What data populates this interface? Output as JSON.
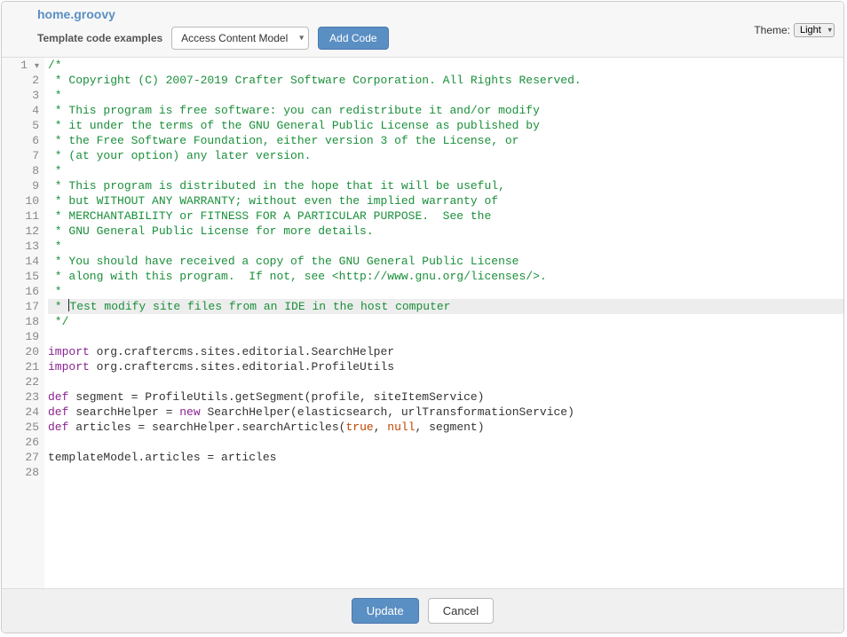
{
  "filename": "home.groovy",
  "template_label": "Template code examples",
  "model_select": "Access Content Model",
  "add_code_label": "Add Code",
  "theme_label": "Theme:",
  "theme_value": "Light",
  "update_label": "Update",
  "cancel_label": "Cancel",
  "active_line": 17,
  "code": {
    "lines": [
      {
        "n": 1,
        "fold": true,
        "spans": [
          {
            "t": "/*",
            "c": "comment"
          }
        ]
      },
      {
        "n": 2,
        "spans": [
          {
            "t": " * Copyright (C) 2007-2019 Crafter Software Corporation. All Rights Reserved.",
            "c": "comment"
          }
        ]
      },
      {
        "n": 3,
        "spans": [
          {
            "t": " *",
            "c": "comment"
          }
        ]
      },
      {
        "n": 4,
        "spans": [
          {
            "t": " * This program is free software: you can redistribute it and/or modify",
            "c": "comment"
          }
        ]
      },
      {
        "n": 5,
        "spans": [
          {
            "t": " * it under the terms of the GNU General Public License as published by",
            "c": "comment"
          }
        ]
      },
      {
        "n": 6,
        "spans": [
          {
            "t": " * the Free Software Foundation, either version 3 of the License, or",
            "c": "comment"
          }
        ]
      },
      {
        "n": 7,
        "spans": [
          {
            "t": " * (at your option) any later version.",
            "c": "comment"
          }
        ]
      },
      {
        "n": 8,
        "spans": [
          {
            "t": " *",
            "c": "comment"
          }
        ]
      },
      {
        "n": 9,
        "spans": [
          {
            "t": " * This program is distributed in the hope that it will be useful,",
            "c": "comment"
          }
        ]
      },
      {
        "n": 10,
        "spans": [
          {
            "t": " * but WITHOUT ANY WARRANTY; without even the implied warranty of",
            "c": "comment"
          }
        ]
      },
      {
        "n": 11,
        "spans": [
          {
            "t": " * MERCHANTABILITY or FITNESS FOR A PARTICULAR PURPOSE.  See the",
            "c": "comment"
          }
        ]
      },
      {
        "n": 12,
        "spans": [
          {
            "t": " * GNU General Public License for more details.",
            "c": "comment"
          }
        ]
      },
      {
        "n": 13,
        "spans": [
          {
            "t": " *",
            "c": "comment"
          }
        ]
      },
      {
        "n": 14,
        "spans": [
          {
            "t": " * You should have received a copy of the GNU General Public License",
            "c": "comment"
          }
        ]
      },
      {
        "n": 15,
        "spans": [
          {
            "t": " * along with this program.  If not, see <http://www.gnu.org/licenses/>.",
            "c": "comment"
          }
        ]
      },
      {
        "n": 16,
        "spans": [
          {
            "t": " *",
            "c": "comment"
          }
        ]
      },
      {
        "n": 17,
        "spans": [
          {
            "t": " * ",
            "c": "comment"
          },
          {
            "cursor": true
          },
          {
            "t": "Test modify site files from an IDE in the host computer",
            "c": "comment"
          }
        ]
      },
      {
        "n": 18,
        "spans": [
          {
            "t": " */",
            "c": "comment"
          }
        ]
      },
      {
        "n": 19,
        "spans": [
          {
            "t": "",
            "c": ""
          }
        ]
      },
      {
        "n": 20,
        "spans": [
          {
            "t": "import",
            "c": "keyword"
          },
          {
            "t": " org.craftercms.sites.editorial.SearchHelper",
            "c": ""
          }
        ]
      },
      {
        "n": 21,
        "spans": [
          {
            "t": "import",
            "c": "keyword"
          },
          {
            "t": " org.craftercms.sites.editorial.ProfileUtils",
            "c": ""
          }
        ]
      },
      {
        "n": 22,
        "spans": [
          {
            "t": "",
            "c": ""
          }
        ]
      },
      {
        "n": 23,
        "spans": [
          {
            "t": "def",
            "c": "def"
          },
          {
            "t": " segment = ProfileUtils.getSegment(profile, siteItemService)",
            "c": ""
          }
        ]
      },
      {
        "n": 24,
        "spans": [
          {
            "t": "def",
            "c": "def"
          },
          {
            "t": " searchHelper = ",
            "c": ""
          },
          {
            "t": "new",
            "c": "keyword"
          },
          {
            "t": " SearchHelper(elasticsearch, urlTransformationService)",
            "c": ""
          }
        ]
      },
      {
        "n": 25,
        "spans": [
          {
            "t": "def",
            "c": "def"
          },
          {
            "t": " articles = searchHelper.searchArticles(",
            "c": ""
          },
          {
            "t": "true",
            "c": "bool"
          },
          {
            "t": ", ",
            "c": ""
          },
          {
            "t": "null",
            "c": "bool"
          },
          {
            "t": ", segment)",
            "c": ""
          }
        ]
      },
      {
        "n": 26,
        "spans": [
          {
            "t": "",
            "c": ""
          }
        ]
      },
      {
        "n": 27,
        "spans": [
          {
            "t": "templateModel.articles = articles",
            "c": ""
          }
        ]
      },
      {
        "n": 28,
        "spans": [
          {
            "t": "",
            "c": ""
          }
        ]
      }
    ]
  }
}
